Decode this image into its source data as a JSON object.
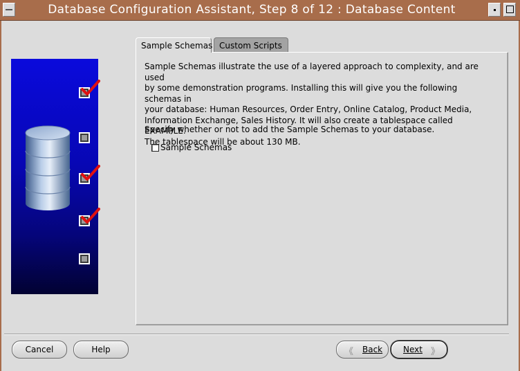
{
  "window": {
    "title": "Database Configuration Assistant, Step 8 of 12 : Database Content"
  },
  "tabs": [
    {
      "label": "Sample Schemas",
      "active": true
    },
    {
      "label": "Custom Scripts",
      "active": false
    }
  ],
  "content": {
    "description_lines": [
      "Sample Schemas illustrate the use of a layered approach to complexity, and are used",
      "by some demonstration programs. Installing this will give you the following schemas in",
      "your database: Human Resources, Order Entry, Online Catalog, Product Media,",
      "Information Exchange, Sales History. It will also create a tablespace called EXAMPLE.",
      "The tablespace will be about 130 MB."
    ],
    "prompt": "Specify whether or not to add the Sample Schemas to your database.",
    "checkbox": {
      "label": "Sample Schemas",
      "checked": false
    }
  },
  "sidebar_steps": [
    {
      "checked": true
    },
    {
      "checked": false
    },
    {
      "checked": true
    },
    {
      "checked": true
    },
    {
      "checked": false
    }
  ],
  "buttons": {
    "cancel": "Cancel",
    "help": "Help",
    "back": "Back",
    "next": "Next"
  },
  "colors": {
    "titlebar": "#a86d4b",
    "image_top": "#0a0adc",
    "image_bottom": "#020232",
    "check_red": "#e01010"
  }
}
